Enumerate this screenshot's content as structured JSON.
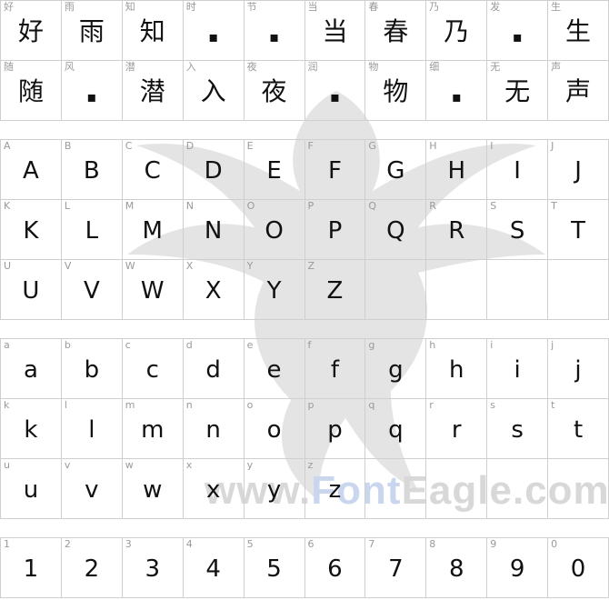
{
  "watermark": {
    "brand_prefix": "www.",
    "brand_accent": "Font",
    "brand_suffix": "Eagle.com"
  },
  "chinese": [
    {
      "label": "好",
      "glyph": "好"
    },
    {
      "label": "雨",
      "glyph": "雨"
    },
    {
      "label": "知",
      "glyph": "知"
    },
    {
      "label": "时",
      "glyph": "▪"
    },
    {
      "label": "节",
      "glyph": "▪"
    },
    {
      "label": "当",
      "glyph": "当"
    },
    {
      "label": "春",
      "glyph": "春"
    },
    {
      "label": "乃",
      "glyph": "乃"
    },
    {
      "label": "发",
      "glyph": "▪"
    },
    {
      "label": "生",
      "glyph": "生"
    },
    {
      "label": "随",
      "glyph": "随"
    },
    {
      "label": "风",
      "glyph": "▪"
    },
    {
      "label": "潜",
      "glyph": "潜"
    },
    {
      "label": "入",
      "glyph": "入"
    },
    {
      "label": "夜",
      "glyph": "夜"
    },
    {
      "label": "润",
      "glyph": "▪"
    },
    {
      "label": "物",
      "glyph": "物"
    },
    {
      "label": "细",
      "glyph": "▪"
    },
    {
      "label": "无",
      "glyph": "无"
    },
    {
      "label": "声",
      "glyph": "声"
    }
  ],
  "uppercase": [
    {
      "label": "A",
      "glyph": "A"
    },
    {
      "label": "B",
      "glyph": "B"
    },
    {
      "label": "C",
      "glyph": "C"
    },
    {
      "label": "D",
      "glyph": "D"
    },
    {
      "label": "E",
      "glyph": "E"
    },
    {
      "label": "F",
      "glyph": "F"
    },
    {
      "label": "G",
      "glyph": "G"
    },
    {
      "label": "H",
      "glyph": "H"
    },
    {
      "label": "I",
      "glyph": "I"
    },
    {
      "label": "J",
      "glyph": "J"
    },
    {
      "label": "K",
      "glyph": "K"
    },
    {
      "label": "L",
      "glyph": "L"
    },
    {
      "label": "M",
      "glyph": "M"
    },
    {
      "label": "N",
      "glyph": "N"
    },
    {
      "label": "O",
      "glyph": "O"
    },
    {
      "label": "P",
      "glyph": "P"
    },
    {
      "label": "Q",
      "glyph": "Q"
    },
    {
      "label": "R",
      "glyph": "R"
    },
    {
      "label": "S",
      "glyph": "S"
    },
    {
      "label": "T",
      "glyph": "T"
    },
    {
      "label": "U",
      "glyph": "U"
    },
    {
      "label": "V",
      "glyph": "V"
    },
    {
      "label": "W",
      "glyph": "W"
    },
    {
      "label": "X",
      "glyph": "X"
    },
    {
      "label": "Y",
      "glyph": "Y"
    },
    {
      "label": "Z",
      "glyph": "Z"
    },
    {
      "label": "",
      "glyph": ""
    },
    {
      "label": "",
      "glyph": ""
    },
    {
      "label": "",
      "glyph": ""
    },
    {
      "label": "",
      "glyph": ""
    }
  ],
  "lowercase": [
    {
      "label": "a",
      "glyph": "a"
    },
    {
      "label": "b",
      "glyph": "b"
    },
    {
      "label": "c",
      "glyph": "c"
    },
    {
      "label": "d",
      "glyph": "d"
    },
    {
      "label": "e",
      "glyph": "e"
    },
    {
      "label": "f",
      "glyph": "f"
    },
    {
      "label": "g",
      "glyph": "g"
    },
    {
      "label": "h",
      "glyph": "h"
    },
    {
      "label": "i",
      "glyph": "i"
    },
    {
      "label": "j",
      "glyph": "j"
    },
    {
      "label": "k",
      "glyph": "k"
    },
    {
      "label": "l",
      "glyph": "l"
    },
    {
      "label": "m",
      "glyph": "m"
    },
    {
      "label": "n",
      "glyph": "n"
    },
    {
      "label": "o",
      "glyph": "o"
    },
    {
      "label": "p",
      "glyph": "p"
    },
    {
      "label": "q",
      "glyph": "q"
    },
    {
      "label": "r",
      "glyph": "r"
    },
    {
      "label": "s",
      "glyph": "s"
    },
    {
      "label": "t",
      "glyph": "t"
    },
    {
      "label": "u",
      "glyph": "u"
    },
    {
      "label": "v",
      "glyph": "v"
    },
    {
      "label": "w",
      "glyph": "w"
    },
    {
      "label": "x",
      "glyph": "x"
    },
    {
      "label": "y",
      "glyph": "y"
    },
    {
      "label": "z",
      "glyph": "z"
    },
    {
      "label": "",
      "glyph": ""
    },
    {
      "label": "",
      "glyph": ""
    },
    {
      "label": "",
      "glyph": ""
    },
    {
      "label": "",
      "glyph": ""
    }
  ],
  "digits": [
    {
      "label": "1",
      "glyph": "1"
    },
    {
      "label": "2",
      "glyph": "2"
    },
    {
      "label": "3",
      "glyph": "3"
    },
    {
      "label": "4",
      "glyph": "4"
    },
    {
      "label": "5",
      "glyph": "5"
    },
    {
      "label": "6",
      "glyph": "6"
    },
    {
      "label": "7",
      "glyph": "7"
    },
    {
      "label": "8",
      "glyph": "8"
    },
    {
      "label": "9",
      "glyph": "9"
    },
    {
      "label": "0",
      "glyph": "0"
    }
  ]
}
